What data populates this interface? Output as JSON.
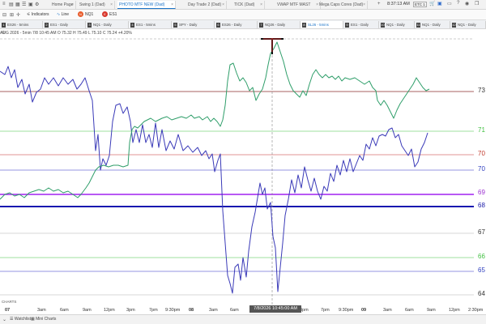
{
  "topbar": {
    "tabs": [
      "Home Page",
      "Swing 1 (Dad)",
      "PHOTO MTF NEW (Dad)",
      "Day Trade 2 (Dad)",
      "TICK (Dad)",
      "VWAP MTF MAST",
      "Mega Caps Cores (Dad)"
    ],
    "time": "8:37:13 AM",
    "badge": "ETC 1"
  },
  "toolbar": {
    "indicators": "Indicators",
    "line": "Line",
    "nq": "NQ1",
    "es": "ES1"
  },
  "chart_tabs": [
    {
      "num": "1",
      "label": "ES26 - 5mins"
    },
    {
      "num": "2",
      "label": "ES1 - Daily"
    },
    {
      "num": "3",
      "label": "NQ1 - Daily"
    },
    {
      "num": "4",
      "label": "ES1 - 5mins"
    },
    {
      "num": "5",
      "label": "SPY - Daily"
    },
    {
      "num": "6",
      "label": "ES26 - Daily"
    },
    {
      "num": "7",
      "label": "NQ26 - Daily"
    },
    {
      "num": "8",
      "label": "SL26 - 5mins"
    },
    {
      "num": "9",
      "label": "ES1 - Daily"
    },
    {
      "num": "10",
      "label": "NQ1 - Daily"
    },
    {
      "num": "11",
      "label": "NQ1 - Daily"
    },
    {
      "num": "12",
      "label": "NQ1 - Daily"
    }
  ],
  "infobar": {
    "text": "AUG 2026 - 5min   7/8 10:45 AM   O 75.32   H 75.49   L 75.10   C 75.24   +4.20%"
  },
  "price_labels": [
    {
      "text": "73",
      "color": "#333333"
    },
    {
      "text": "71",
      "color": "#3fbf3f"
    },
    {
      "text": "70",
      "color": "#c0392b"
    },
    {
      "text": "70",
      "color": "#2f3fbf"
    },
    {
      "text": "69",
      "color": "#9b30d0"
    },
    {
      "text": "68",
      "color": "#1a1aa8"
    },
    {
      "text": "67",
      "color": "#333333"
    },
    {
      "text": "66",
      "color": "#3fbf3f"
    },
    {
      "text": "65",
      "color": "#2f3fbf"
    },
    {
      "text": "64",
      "color": "#333333"
    }
  ],
  "time_labels": [
    {
      "text": "07",
      "bold": true
    },
    {
      "text": "3am"
    },
    {
      "text": "6am"
    },
    {
      "text": "9am"
    },
    {
      "text": "12pm"
    },
    {
      "text": "3pm"
    },
    {
      "text": "7pm"
    },
    {
      "text": "9:30pm"
    },
    {
      "text": "08",
      "bold": true
    },
    {
      "text": "3am"
    },
    {
      "text": "6am"
    },
    {
      "text": "3pm"
    },
    {
      "text": "7pm"
    },
    {
      "text": "9:30pm"
    },
    {
      "text": "09",
      "bold": true
    },
    {
      "text": "3am"
    },
    {
      "text": "6am"
    },
    {
      "text": "9am"
    },
    {
      "text": "12pm"
    },
    {
      "text": "2:30pm"
    }
  ],
  "crosshair_time": "7/8/2026 10:45:00 AM",
  "corner_label": "CHARTS",
  "bottombar": {
    "watchlist": "Watchlist",
    "mini": "Mini Charts"
  }
}
